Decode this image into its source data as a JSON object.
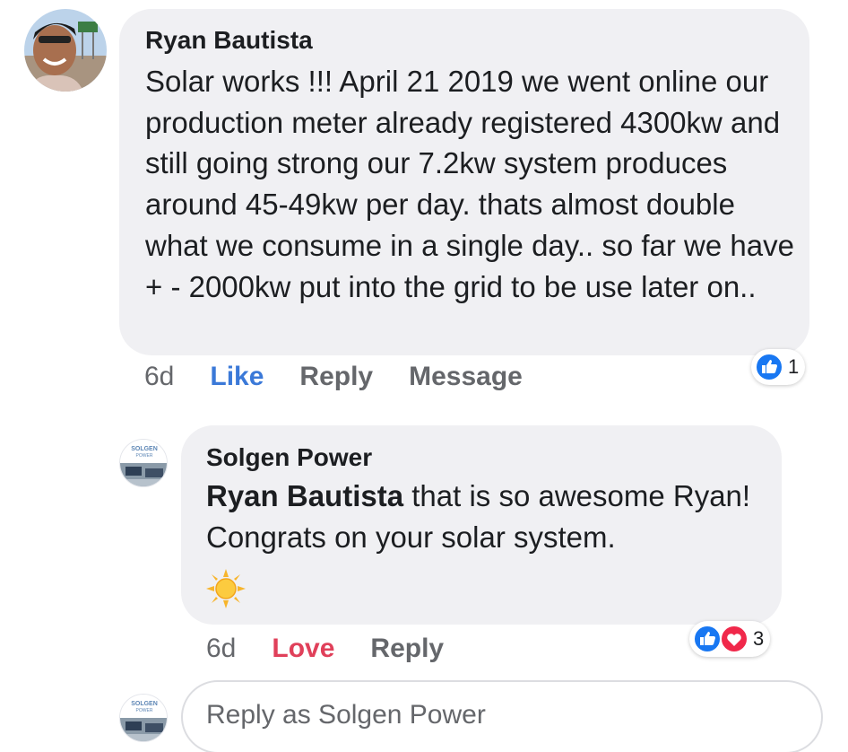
{
  "comment": {
    "author": "Ryan Bautista",
    "text": "Solar works !!! April 21 2019 we went online our production meter already registered 4300kw and still going strong our 7.2kw system produces around 45-49kw per day. thats almost double what we consume in a single day.. so far we have + - 2000kw put into the grid to be use later on..",
    "time": "6d",
    "actions": {
      "like": "Like",
      "reply": "Reply",
      "message": "Message"
    },
    "reaction_count": "1",
    "reaction_colors": {
      "like": "#1877f2"
    }
  },
  "reply": {
    "author": "Solgen Power",
    "mention": "Ryan Bautista",
    "text": " that is so awesome Ryan! Congrats on your solar system.",
    "emoji": "sun-emoji",
    "time": "6d",
    "actions": {
      "love": "Love",
      "reply": "Reply"
    },
    "reaction_count": "3",
    "reaction_colors": {
      "like": "#1877f2",
      "love": "#f0284a"
    }
  },
  "composer": {
    "placeholder": "Reply as Solgen Power"
  },
  "logo": {
    "line1": "SOLGEN",
    "line2": "POWER"
  },
  "colors": {
    "bubble": "#f0f0f3",
    "like_link": "#3b79d8",
    "love_link": "#e0405a",
    "secondary_text": "#65676b"
  }
}
